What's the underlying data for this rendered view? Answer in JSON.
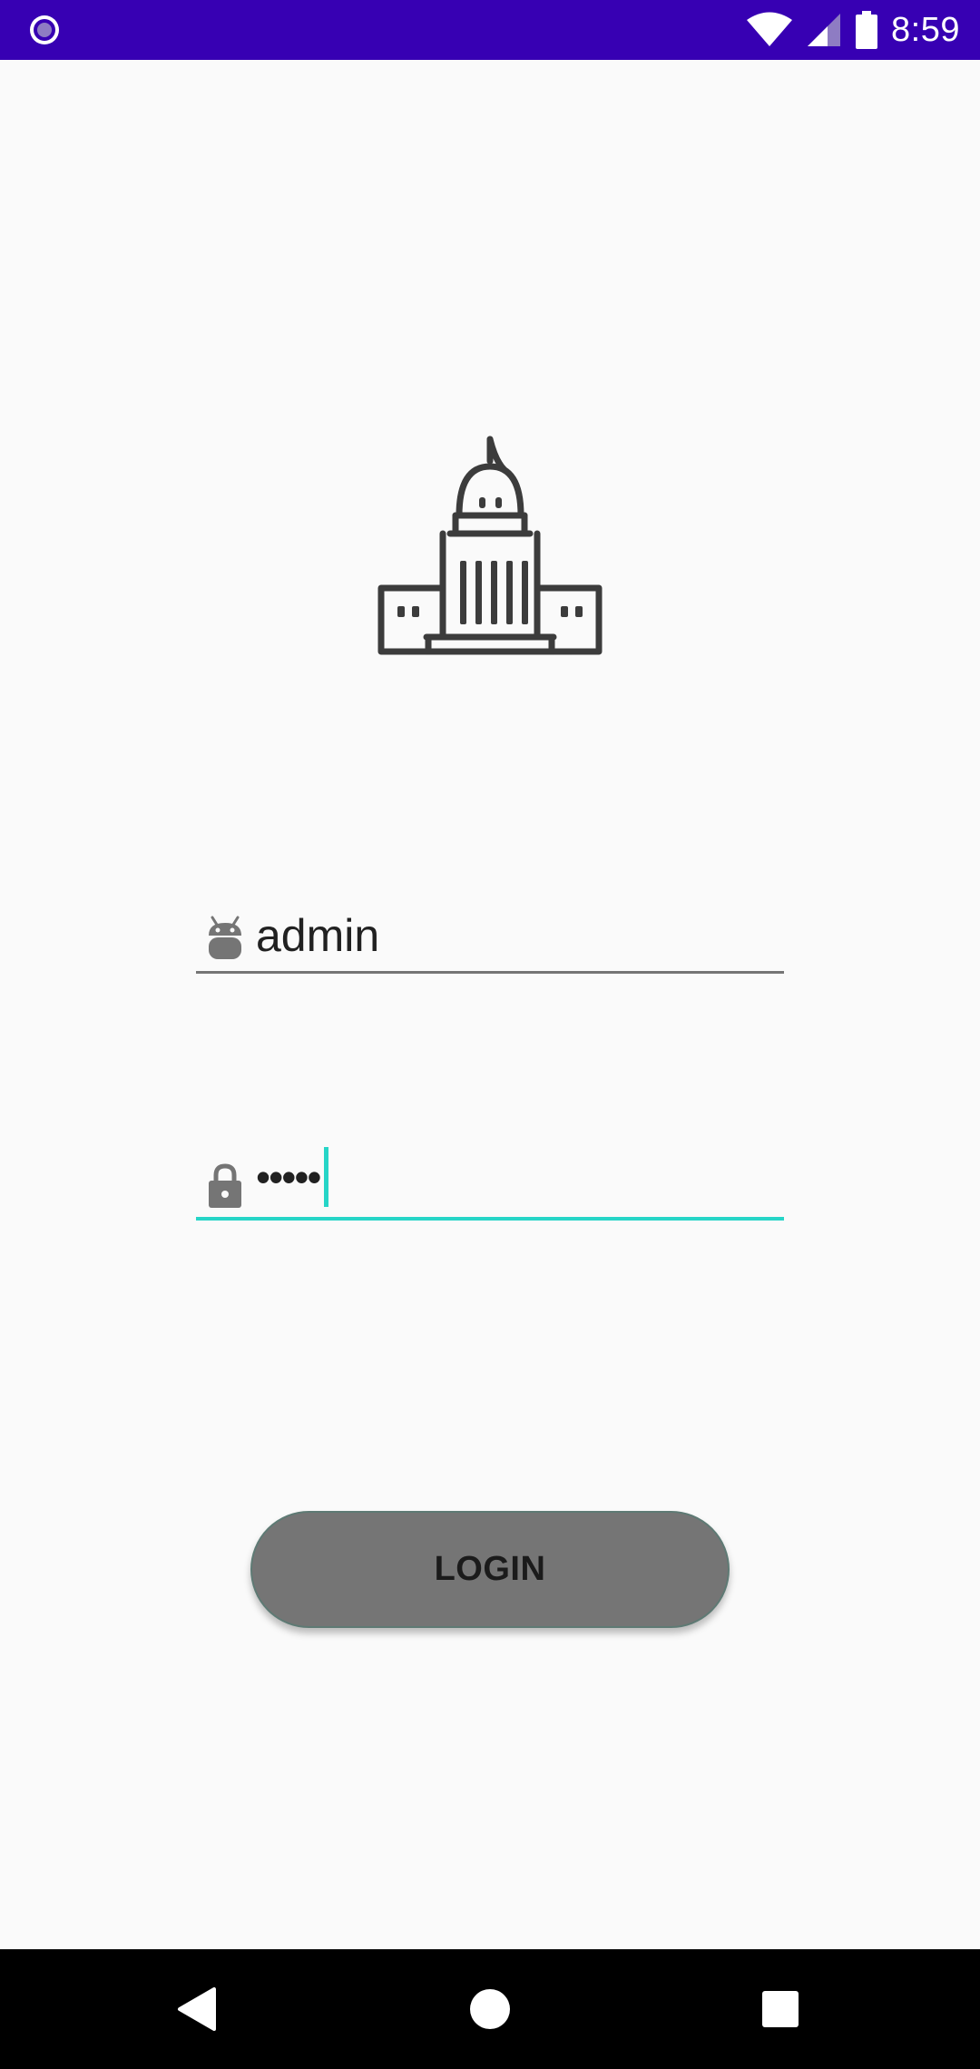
{
  "status_bar": {
    "time": "8:59",
    "background_color": "#3700b3",
    "icons": [
      "notification-circle-icon",
      "wifi-icon",
      "cellular-signal-icon",
      "battery-icon"
    ]
  },
  "logo": {
    "icon": "capitol-building-icon"
  },
  "login_form": {
    "username": {
      "icon": "android-icon",
      "value": "admin",
      "underline_color": "#757575"
    },
    "password": {
      "icon": "lock-icon",
      "value": "•••••",
      "underline_color": "#26d5c7",
      "focused": true
    },
    "login_button": {
      "label": "LOGIN",
      "background_color": "#757575"
    }
  },
  "nav_bar": {
    "buttons": [
      "back-icon",
      "home-icon",
      "recents-icon"
    ]
  }
}
